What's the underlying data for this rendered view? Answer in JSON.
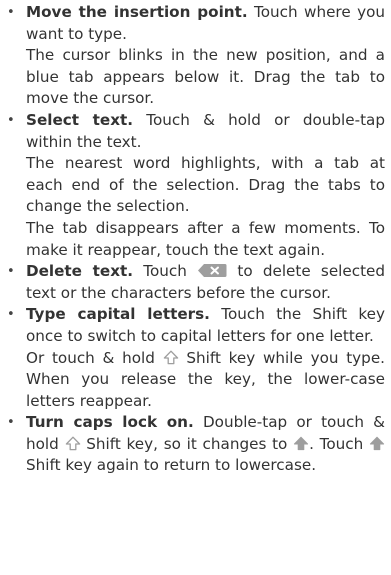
{
  "items": [
    {
      "lead": "Move the insertion point.",
      "text1": "Touch where you want to type.",
      "text2": "The cursor blinks in the new position, and a blue tab appears below it. Drag the tab to move the cursor."
    },
    {
      "lead": "Select text.",
      "text1": "Touch & hold or double-tap within the text.",
      "text2": "The nearest word highlights, with a tab at each end of the selection. Drag the tabs to change the selection.",
      "text3": "The tab disappears after a few moments. To make it reappear, touch the text again."
    },
    {
      "lead": "Delete text.",
      "pre": "Touch",
      "post": "to delete selected text or the characters before the cursor."
    },
    {
      "lead": "Type capital letters.",
      "text1": "Touch the Shift key once to switch to capital letters for one letter.",
      "pre2": "Or touch & hold",
      "post2": "Shift key while you type. When you release the key, the lower-case letters reappear."
    },
    {
      "lead": "Turn caps lock on.",
      "pre": "Double-tap or touch & hold",
      "mid": "Shift key, so it changes to",
      "mid2": ". Touch",
      "post": "Shift key again to return to lowercase."
    }
  ],
  "icons": {
    "delete": "backspace-key-icon",
    "shift": "shift-outline-icon",
    "caps": "shift-filled-icon"
  },
  "colors": {
    "text": "#333333",
    "delete_key": "#9e9e9e",
    "shift_outline": "#9e9e9e",
    "caps_filled": "#9e9e9e"
  }
}
